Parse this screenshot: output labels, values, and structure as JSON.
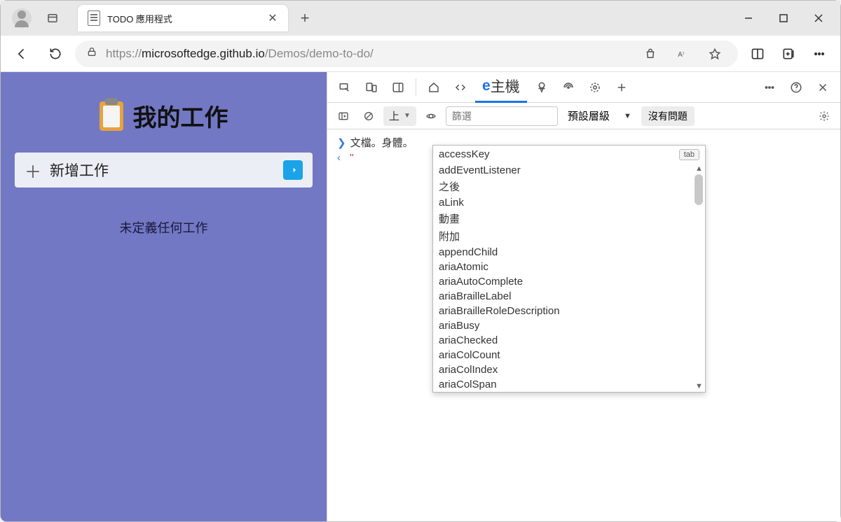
{
  "browser": {
    "tab_title": "TODO 應用程式",
    "url_prefix": "https://",
    "url_dark": "microsoftedge.github.io",
    "url_rest": "/Demos/demo-to-do/"
  },
  "app": {
    "title": "我的工作",
    "add_label": "新增工作",
    "empty": "未定義任何工作"
  },
  "devtools": {
    "tab_console_prefix": "e",
    "tab_console_label": " 主機",
    "toolbar": {
      "top_label": "上",
      "filter_placeholder": "篩選",
      "level_label": "預設層級",
      "no_issues": "沒有問題"
    },
    "breadcrumb": "文檔。身體。",
    "prompt_quotes": "''",
    "autocomplete": {
      "tab_key": "tab",
      "items": [
        "accessKey",
        "addEventListener",
        "之後",
        "aLink",
        "動畫",
        "附加",
        "appendChild",
        "ariaAtomic",
        "ariaAutoComplete",
        "ariaBrailleLabel",
        "ariaBrailleRoleDescription",
        "ariaBusy",
        "ariaChecked",
        "ariaColCount",
        "ariaColIndex",
        "ariaColSpan"
      ]
    }
  }
}
